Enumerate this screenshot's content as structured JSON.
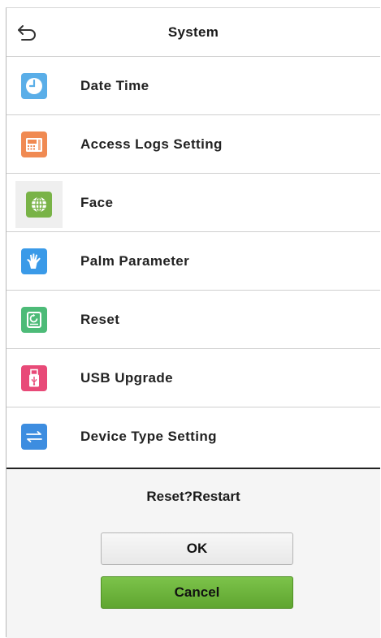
{
  "header": {
    "title": "System",
    "back_icon": "back-arrow-icon"
  },
  "menu": {
    "items": [
      {
        "label": "Date Time",
        "icon": "clock-icon",
        "color": "#5aaee8"
      },
      {
        "label": "Access Logs Setting",
        "icon": "access-log-terminal-icon",
        "color": "#f08a52"
      },
      {
        "label": "Face",
        "icon": "face-globe-icon",
        "color": "#79b347"
      },
      {
        "label": "Palm Parameter",
        "icon": "palm-icon",
        "color": "#3a9ae8"
      },
      {
        "label": "Reset",
        "icon": "reset-icon",
        "color": "#4dbb78"
      },
      {
        "label": "USB Upgrade",
        "icon": "usb-icon",
        "color": "#e84a78"
      },
      {
        "label": "Device Type Setting",
        "icon": "switch-arrows-icon",
        "color": "#3d8de0"
      }
    ]
  },
  "dialog": {
    "message": "Reset?Restart",
    "ok_label": "OK",
    "cancel_label": "Cancel"
  }
}
